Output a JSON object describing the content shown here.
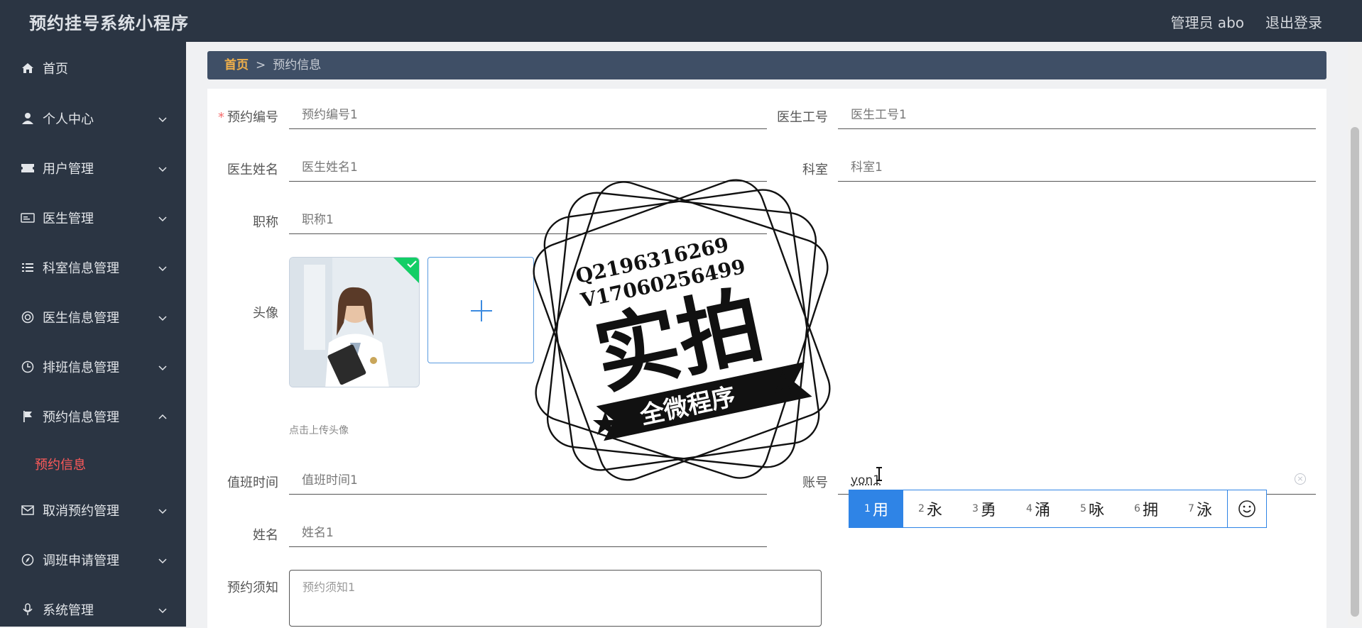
{
  "header": {
    "title": "预约挂号系统小程序",
    "admin": "管理员 abo",
    "logout": "退出登录"
  },
  "sidebar": {
    "items": [
      {
        "label": "首页",
        "icon": "home-icon"
      },
      {
        "label": "个人中心",
        "icon": "user-icon"
      },
      {
        "label": "用户管理",
        "icon": "ticket-icon"
      },
      {
        "label": "医生管理",
        "icon": "id-card-icon"
      },
      {
        "label": "科室信息管理",
        "icon": "list-icon"
      },
      {
        "label": "医生信息管理",
        "icon": "lifebuoy-icon"
      },
      {
        "label": "排班信息管理",
        "icon": "clock-icon"
      },
      {
        "label": "预约信息管理",
        "icon": "flag-icon"
      },
      {
        "label": "取消预约管理",
        "icon": "mail-icon"
      },
      {
        "label": "调班申请管理",
        "icon": "compass-icon"
      },
      {
        "label": "系统管理",
        "icon": "mic-icon"
      }
    ],
    "active_sub": "预约信息"
  },
  "breadcrumb": {
    "home": "首页",
    "sep": ">",
    "current": "预约信息"
  },
  "form": {
    "appt_no": {
      "label": "预约编号",
      "value": "预约编号1"
    },
    "doctor_id": {
      "label": "医生工号",
      "value": "医生工号1"
    },
    "doctor_name": {
      "label": "医生姓名",
      "value": "医生姓名1"
    },
    "dept": {
      "label": "科室",
      "value": "科室1"
    },
    "title": {
      "label": "职称",
      "value": "职称1"
    },
    "avatar": {
      "label": "头像",
      "tip": "点击上传头像"
    },
    "duty_time": {
      "label": "值班时间",
      "value": "值班时间1"
    },
    "account": {
      "label": "账号",
      "value": "yon1"
    },
    "name": {
      "label": "姓名",
      "value": "姓名1"
    },
    "notice": {
      "label": "预约须知",
      "value": "预约须知1"
    }
  },
  "ime": {
    "candidates": [
      {
        "n": "1",
        "c": "用"
      },
      {
        "n": "2",
        "c": "永"
      },
      {
        "n": "3",
        "c": "勇"
      },
      {
        "n": "4",
        "c": "涌"
      },
      {
        "n": "5",
        "c": "咏"
      },
      {
        "n": "6",
        "c": "拥"
      },
      {
        "n": "7",
        "c": "泳"
      }
    ]
  },
  "watermark": {
    "line1": "Q2196316269",
    "line2": "V17060256499",
    "main": "实拍",
    "ribbon": "全微程序"
  }
}
